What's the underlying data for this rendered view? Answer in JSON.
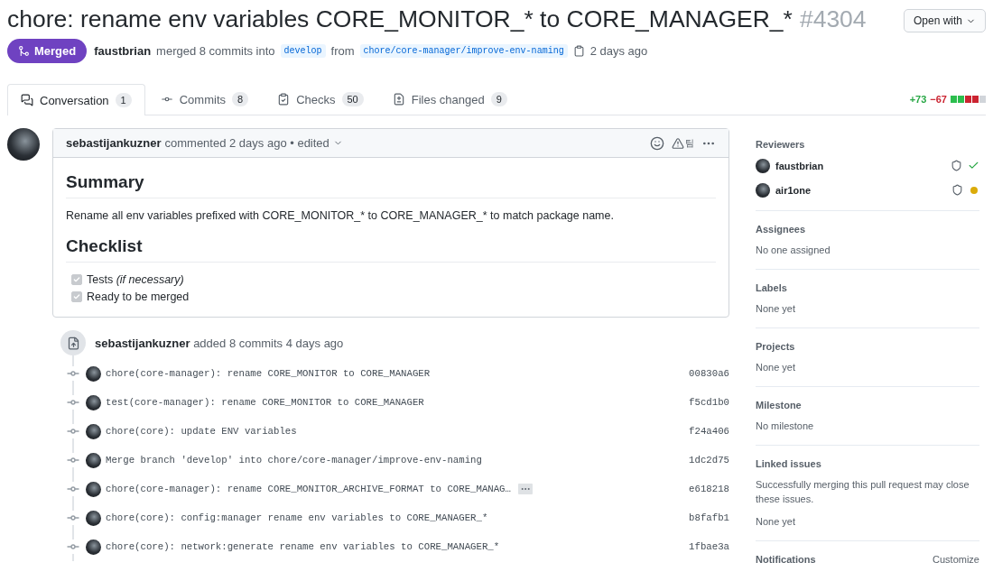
{
  "title": {
    "text": "chore: rename env variables CORE_MONITOR_* to CORE_MANAGER_*",
    "number": "#4304"
  },
  "open_with": "Open with",
  "status": {
    "label": "Merged",
    "kind": "merged"
  },
  "merge_info": {
    "author": "faustbrian",
    "action": "merged 8 commits into",
    "base": "develop",
    "from": "from",
    "head": "chore/core-manager/improve-env-naming",
    "time": "2 days ago"
  },
  "tabs": [
    {
      "label": "Conversation",
      "count": "1",
      "selected": true,
      "kind": "conversation"
    },
    {
      "label": "Commits",
      "count": "8",
      "selected": false,
      "kind": "commits"
    },
    {
      "label": "Checks",
      "count": "50",
      "selected": false,
      "kind": "checks"
    },
    {
      "label": "Files changed",
      "count": "9",
      "selected": false,
      "kind": "files"
    }
  ],
  "diffstat": {
    "additions": "+73",
    "deletions": "−67",
    "blocks": [
      {
        "kind": "added"
      },
      {
        "kind": "added"
      },
      {
        "kind": "removed"
      },
      {
        "kind": "removed"
      },
      {
        "kind": "neutral"
      }
    ]
  },
  "comment": {
    "author": "sebastijankuzner",
    "meta": "commented 2 days ago • edited",
    "reaction_label": "팀",
    "body": [
      {
        "kind": "heading",
        "text": "Summary"
      },
      {
        "kind": "paragraph",
        "text": "Rename all env variables prefixed with CORE_MONITOR_* to CORE_MANAGER_* to match package name."
      },
      {
        "kind": "heading",
        "text": "Checklist"
      },
      {
        "kind": "task",
        "text": "Tests *(if necessary)*",
        "checked": true
      },
      {
        "kind": "task",
        "text": "Ready to be merged",
        "checked": true
      }
    ]
  },
  "event": {
    "author": "sebastijankuzner",
    "text": "added 8 commits 4 days ago"
  },
  "commits": [
    {
      "message": "chore(core-manager): rename CORE_MONITOR to CORE_MANAGER",
      "sha": "00830a6",
      "expandable": false
    },
    {
      "message": "test(core-manager): rename CORE_MONITOR to CORE_MANAGER",
      "sha": "f5cd1b0",
      "expandable": false
    },
    {
      "message": "chore(core): update ENV variables",
      "sha": "f24a406",
      "expandable": false
    },
    {
      "message": "Merge branch 'develop' into chore/core-manager/improve-env-naming",
      "sha": "1dc2d75",
      "expandable": false
    },
    {
      "message": "chore(core-manager): rename CORE_MONITOR_ARCHIVE_FORMAT to CORE_MANAG…",
      "sha": "e618218",
      "expandable": true
    },
    {
      "message": "chore(core): config:manager rename env variables to CORE_MANAGER_*",
      "sha": "b8fafb1",
      "expandable": false
    },
    {
      "message": "chore(core): network:generate rename env variables to CORE_MANAGER_*",
      "sha": "1fbae3a",
      "expandable": false
    }
  ],
  "sidebar": [
    {
      "title": "Reviewers",
      "reviewers": [
        {
          "name": "faustbrian",
          "kind": "approved"
        },
        {
          "name": "air1one",
          "kind": "pending"
        }
      ]
    },
    {
      "title": "Assignees",
      "lines": [
        "No one assigned"
      ]
    },
    {
      "title": "Labels",
      "lines": [
        "None yet"
      ]
    },
    {
      "title": "Projects",
      "lines": [
        "None yet"
      ]
    },
    {
      "title": "Milestone",
      "lines": [
        "No milestone"
      ]
    },
    {
      "title": "Linked issues",
      "lines": [
        "Successfully merging this pull request may close these issues.",
        "None yet"
      ]
    },
    {
      "title": "Notifications",
      "action": "Customize"
    }
  ]
}
